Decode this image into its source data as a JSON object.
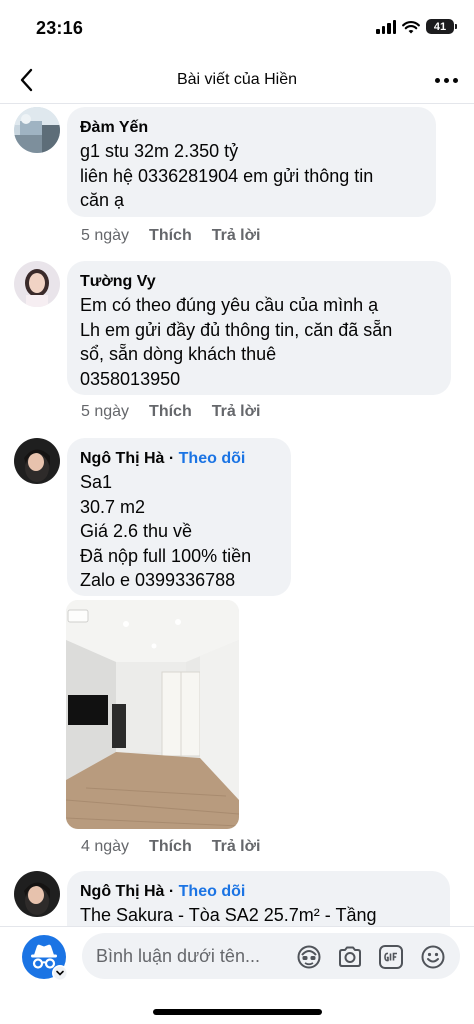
{
  "status_bar": {
    "time": "23:16",
    "battery": "41"
  },
  "header": {
    "title": "Bài viết của Hiền"
  },
  "comments": [
    {
      "author": "Đàm Yến",
      "follow": "",
      "lines": [
        "g1 stu 32m 2.350 tỷ",
        "liên hệ 0336281904 em gửi thông tin",
        "căn ạ"
      ],
      "time": "5 ngày",
      "like": "Thích",
      "reply": "Trả lời"
    },
    {
      "author": "Tường Vy",
      "follow": "",
      "lines": [
        "Em có theo đúng yêu cầu của mình ạ",
        "Lh em gửi đầy đủ thông tin, căn đã sẵn",
        "sổ, sẵn dòng khách thuê",
        "0358013950"
      ],
      "time": "5 ngày",
      "like": "Thích",
      "reply": "Trả lời"
    },
    {
      "author": "Ngô Thị Hà",
      "follow": "Theo dõi",
      "lines": [
        "Sa1",
        "30.7 m2",
        "Giá 2.6 thu về",
        "Đã nộp full 100% tiền",
        "Zalo e 0399336788"
      ],
      "time": "4 ngày",
      "like": "Thích",
      "reply": "Trả lời"
    },
    {
      "author": "Ngô Thị Hà",
      "follow": "Theo dõi",
      "lines": [
        "The Sakura - Tòa SA2 25.7m² - Tầng"
      ],
      "time": "",
      "like": "",
      "reply": ""
    }
  ],
  "separator": " · ",
  "composer": {
    "placeholder": "Bình luận dưới tên..."
  },
  "colors": {
    "bubble": "#f0f2f5",
    "link": "#1b74e4",
    "secondary_text": "#65676b",
    "anon_icon": "#1b74e4"
  }
}
